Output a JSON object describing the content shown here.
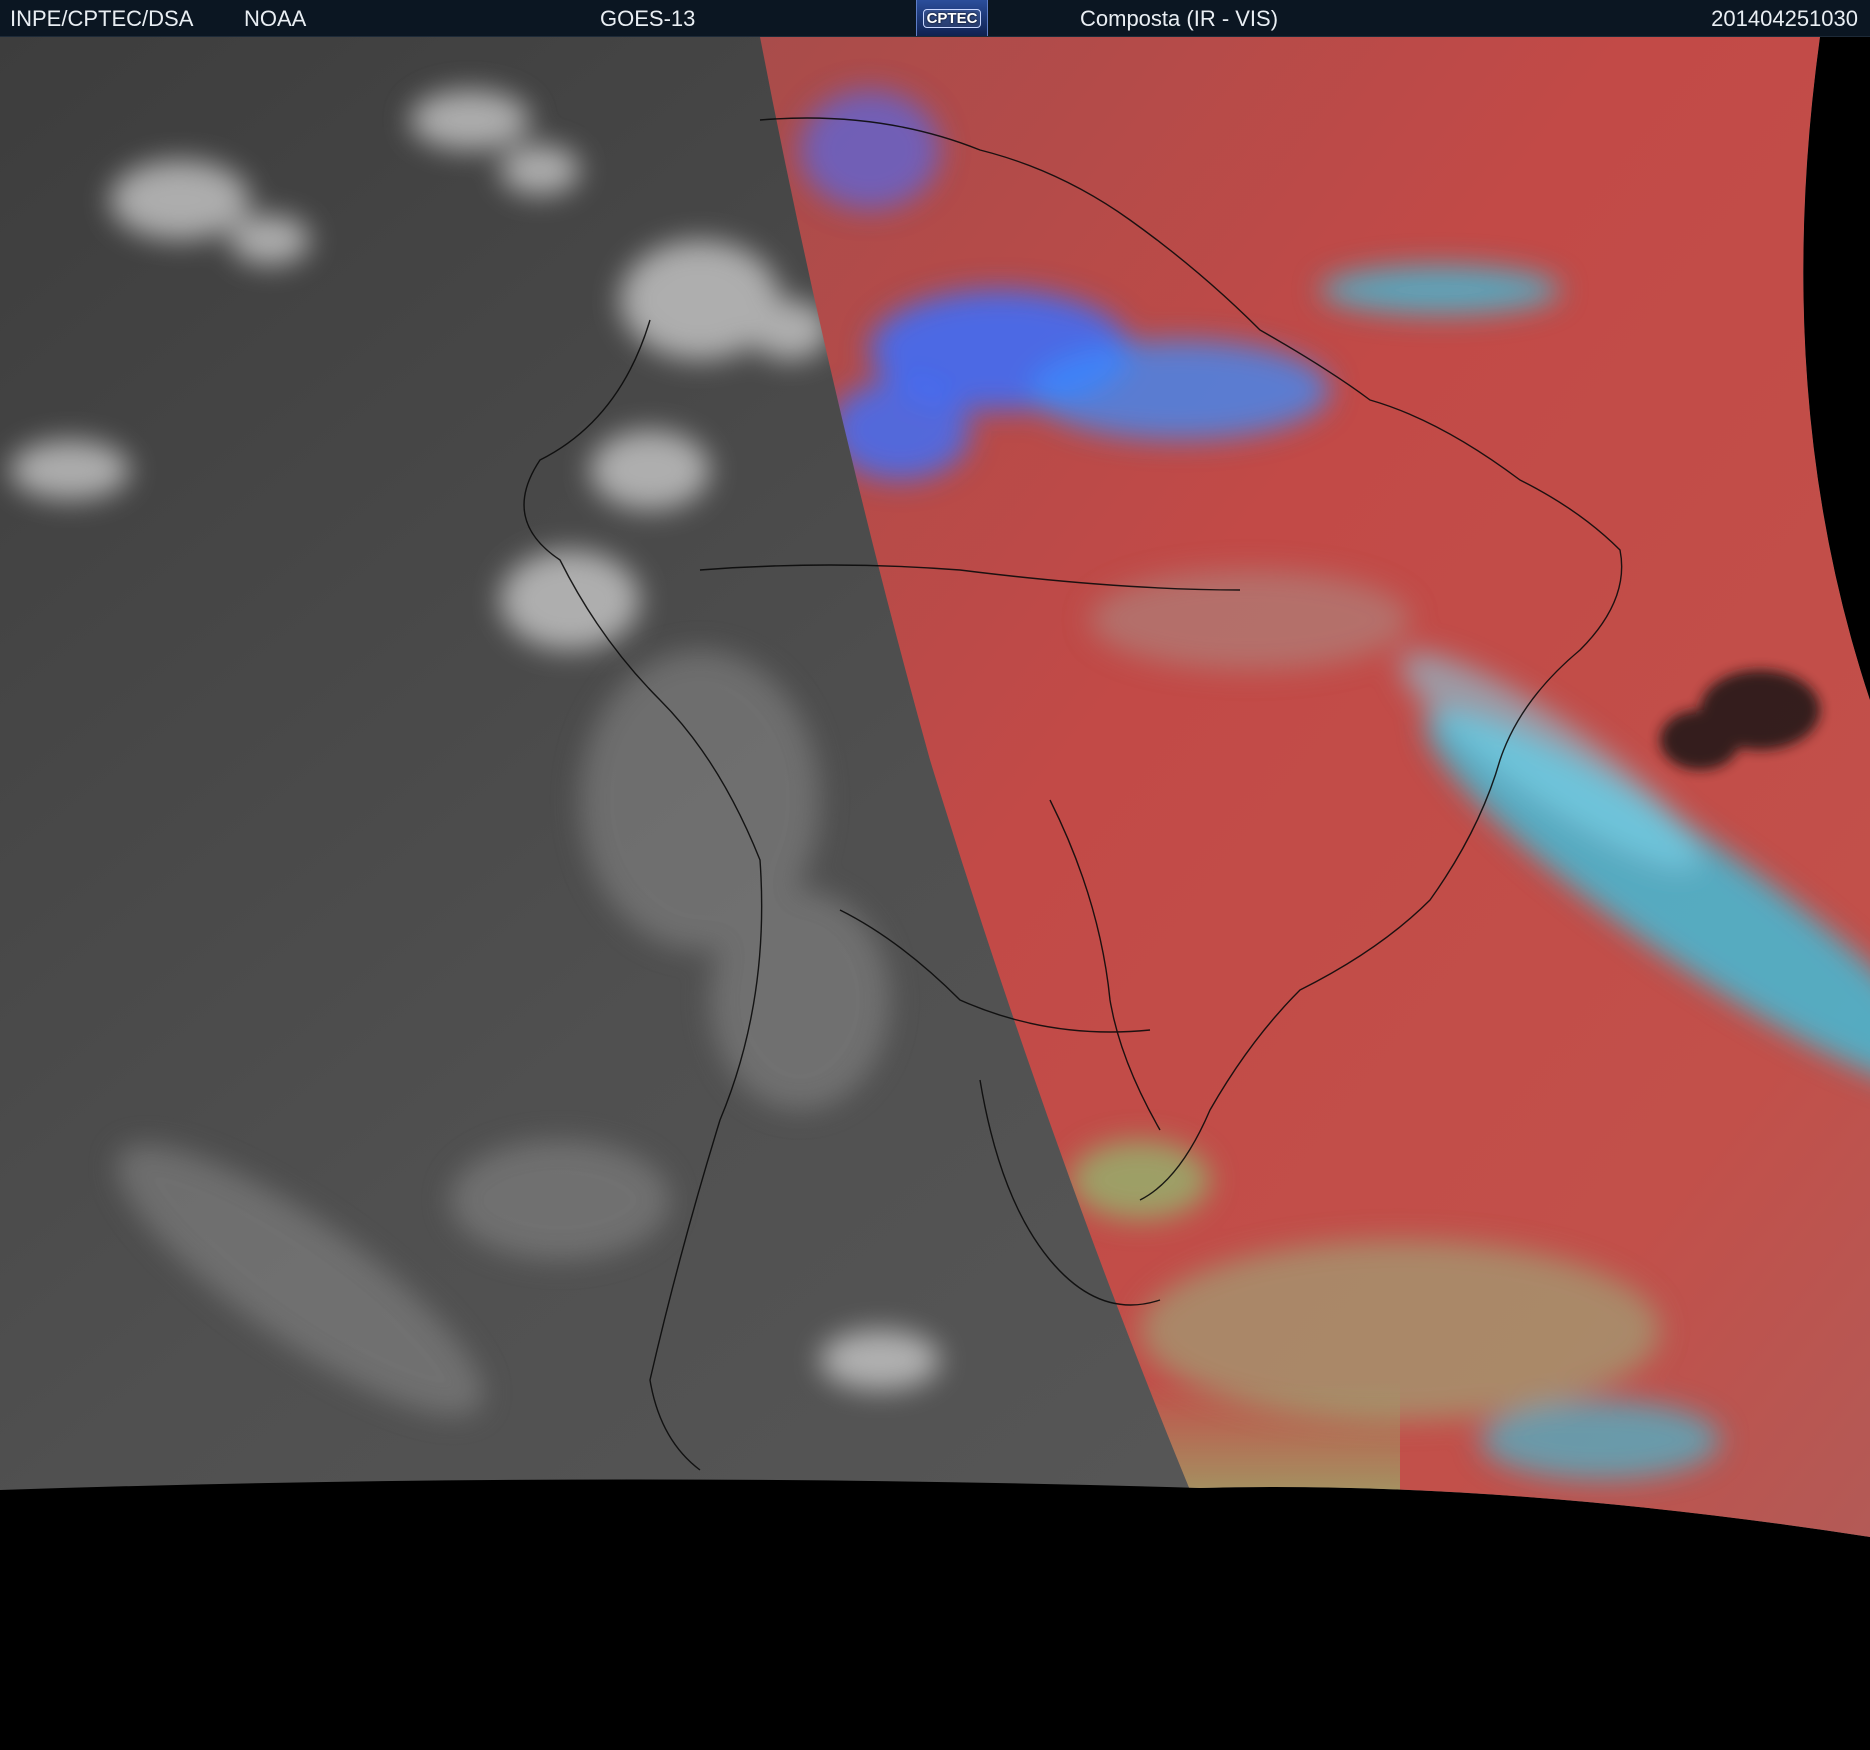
{
  "header": {
    "org": "INPE/CPTEC/DSA",
    "agency": "NOAA",
    "satellite": "GOES-13",
    "logo_text": "CPTEC",
    "product": "Composta (IR - VIS)",
    "timestamp": "201404251030"
  },
  "colors": {
    "background": "#000000",
    "header_bg": "#0b1622",
    "header_text": "#e9eef3",
    "night_side": "#4a4a4a",
    "day_side": "#bf4a47",
    "cloud_cyan": "#33c9e8",
    "cloud_green": "#7fe37f",
    "cloud_blue": "#3b6fff"
  }
}
